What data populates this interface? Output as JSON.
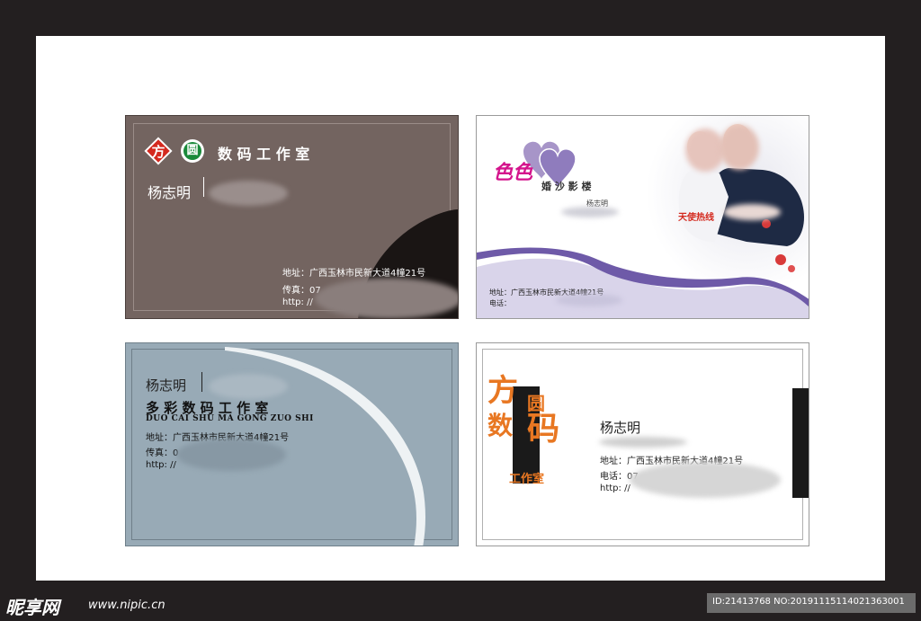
{
  "card1": {
    "logo_fang": "方",
    "logo_yuan": "圆",
    "studio": "数 码 工 作 室",
    "name": "杨志明",
    "address": "地址：广西玉林市民新大道4幢21号",
    "fax": "传真：07",
    "http": "http: //"
  },
  "card2": {
    "brand": "色色",
    "studio": "婚 沙 影 楼",
    "name": "杨志明",
    "hotline": "天使热线",
    "address": "地址：广西玉林市民新大道4幢21号",
    "phone": "电话："
  },
  "card3": {
    "name": "杨志明",
    "studio": "多 彩 数 码 工 作 室",
    "pinyin": "DUO CAI SHU MA GONG ZUO SHI",
    "address": "地址：广西玉林市民新大道4幢21号",
    "fax": "传真：0",
    "http": "http: //"
  },
  "card4": {
    "fang": "方",
    "yuan": "圆",
    "shu": "数",
    "ma": "码",
    "studio": "工作室",
    "name": "杨志明",
    "address": "地址：广西玉林市民新大道4幢21号",
    "phone": "电话：07",
    "http": "http: //"
  },
  "watermark": {
    "logo": "昵享网",
    "url": "www.nipic.cn",
    "id": "ID:21413768 NO:20191115114021363001"
  },
  "colors": {
    "card1_bg": "#736460",
    "card3_bg": "#98aab6",
    "purple": "#7a6aae",
    "orange": "#e87722",
    "magenta": "#d4148c"
  }
}
